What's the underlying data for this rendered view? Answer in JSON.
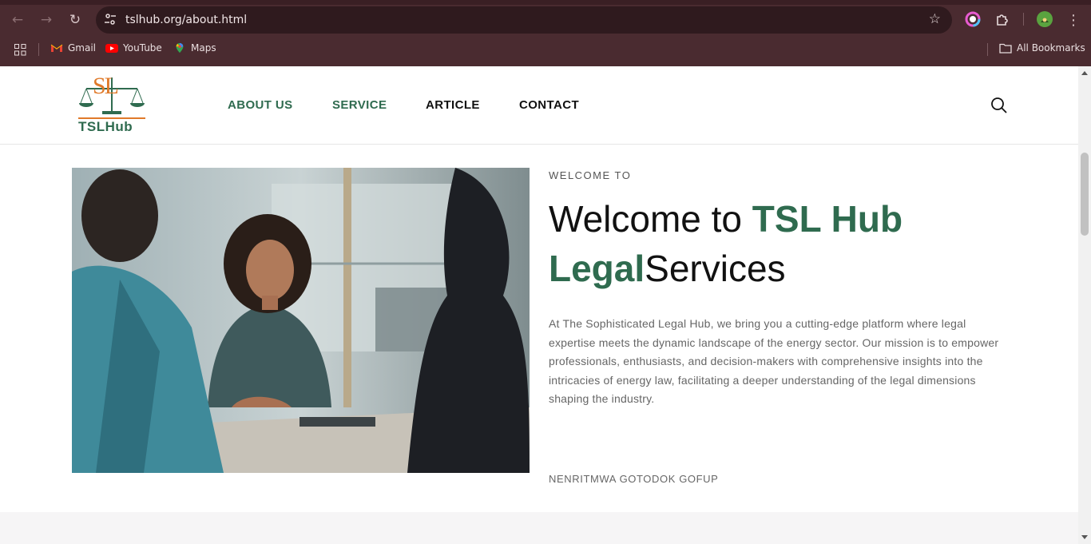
{
  "browser": {
    "url": "tslhub.org/about.html",
    "bookmarks": [
      {
        "label": "Gmail",
        "icon": "gmail-icon"
      },
      {
        "label": "YouTube",
        "icon": "youtube-icon"
      },
      {
        "label": "Maps",
        "icon": "maps-icon"
      }
    ],
    "all_bookmarks_label": "All Bookmarks"
  },
  "site": {
    "logo_text": "TSLHub",
    "logo_mark": "SL",
    "nav": [
      {
        "label": "ABOUT US"
      },
      {
        "label": "SERVICE"
      },
      {
        "label": "ARTICLE"
      },
      {
        "label": "CONTACT"
      }
    ]
  },
  "hero": {
    "eyebrow": "WELCOME TO",
    "headline_part1": "Welcome to ",
    "headline_highlight1": "TSL Hub",
    "headline_highlight2": "Legal",
    "headline_part2": "Services",
    "body": "At The Sophisticated Legal Hub, we bring you a cutting-edge platform where legal expertise meets the dynamic landscape of the energy sector. Our mission is to empower professionals, enthusiasts, and decision-makers with comprehensive insights into the intricacies of energy law, facilitating a deeper understanding of the legal dimensions shaping the industry.",
    "author": "NENRITMWA GOTODOK GOFUP"
  },
  "colors": {
    "brand_green": "#2f6b4f",
    "logo_orange": "#e07a2a",
    "chrome_bg": "#4a2b30"
  }
}
